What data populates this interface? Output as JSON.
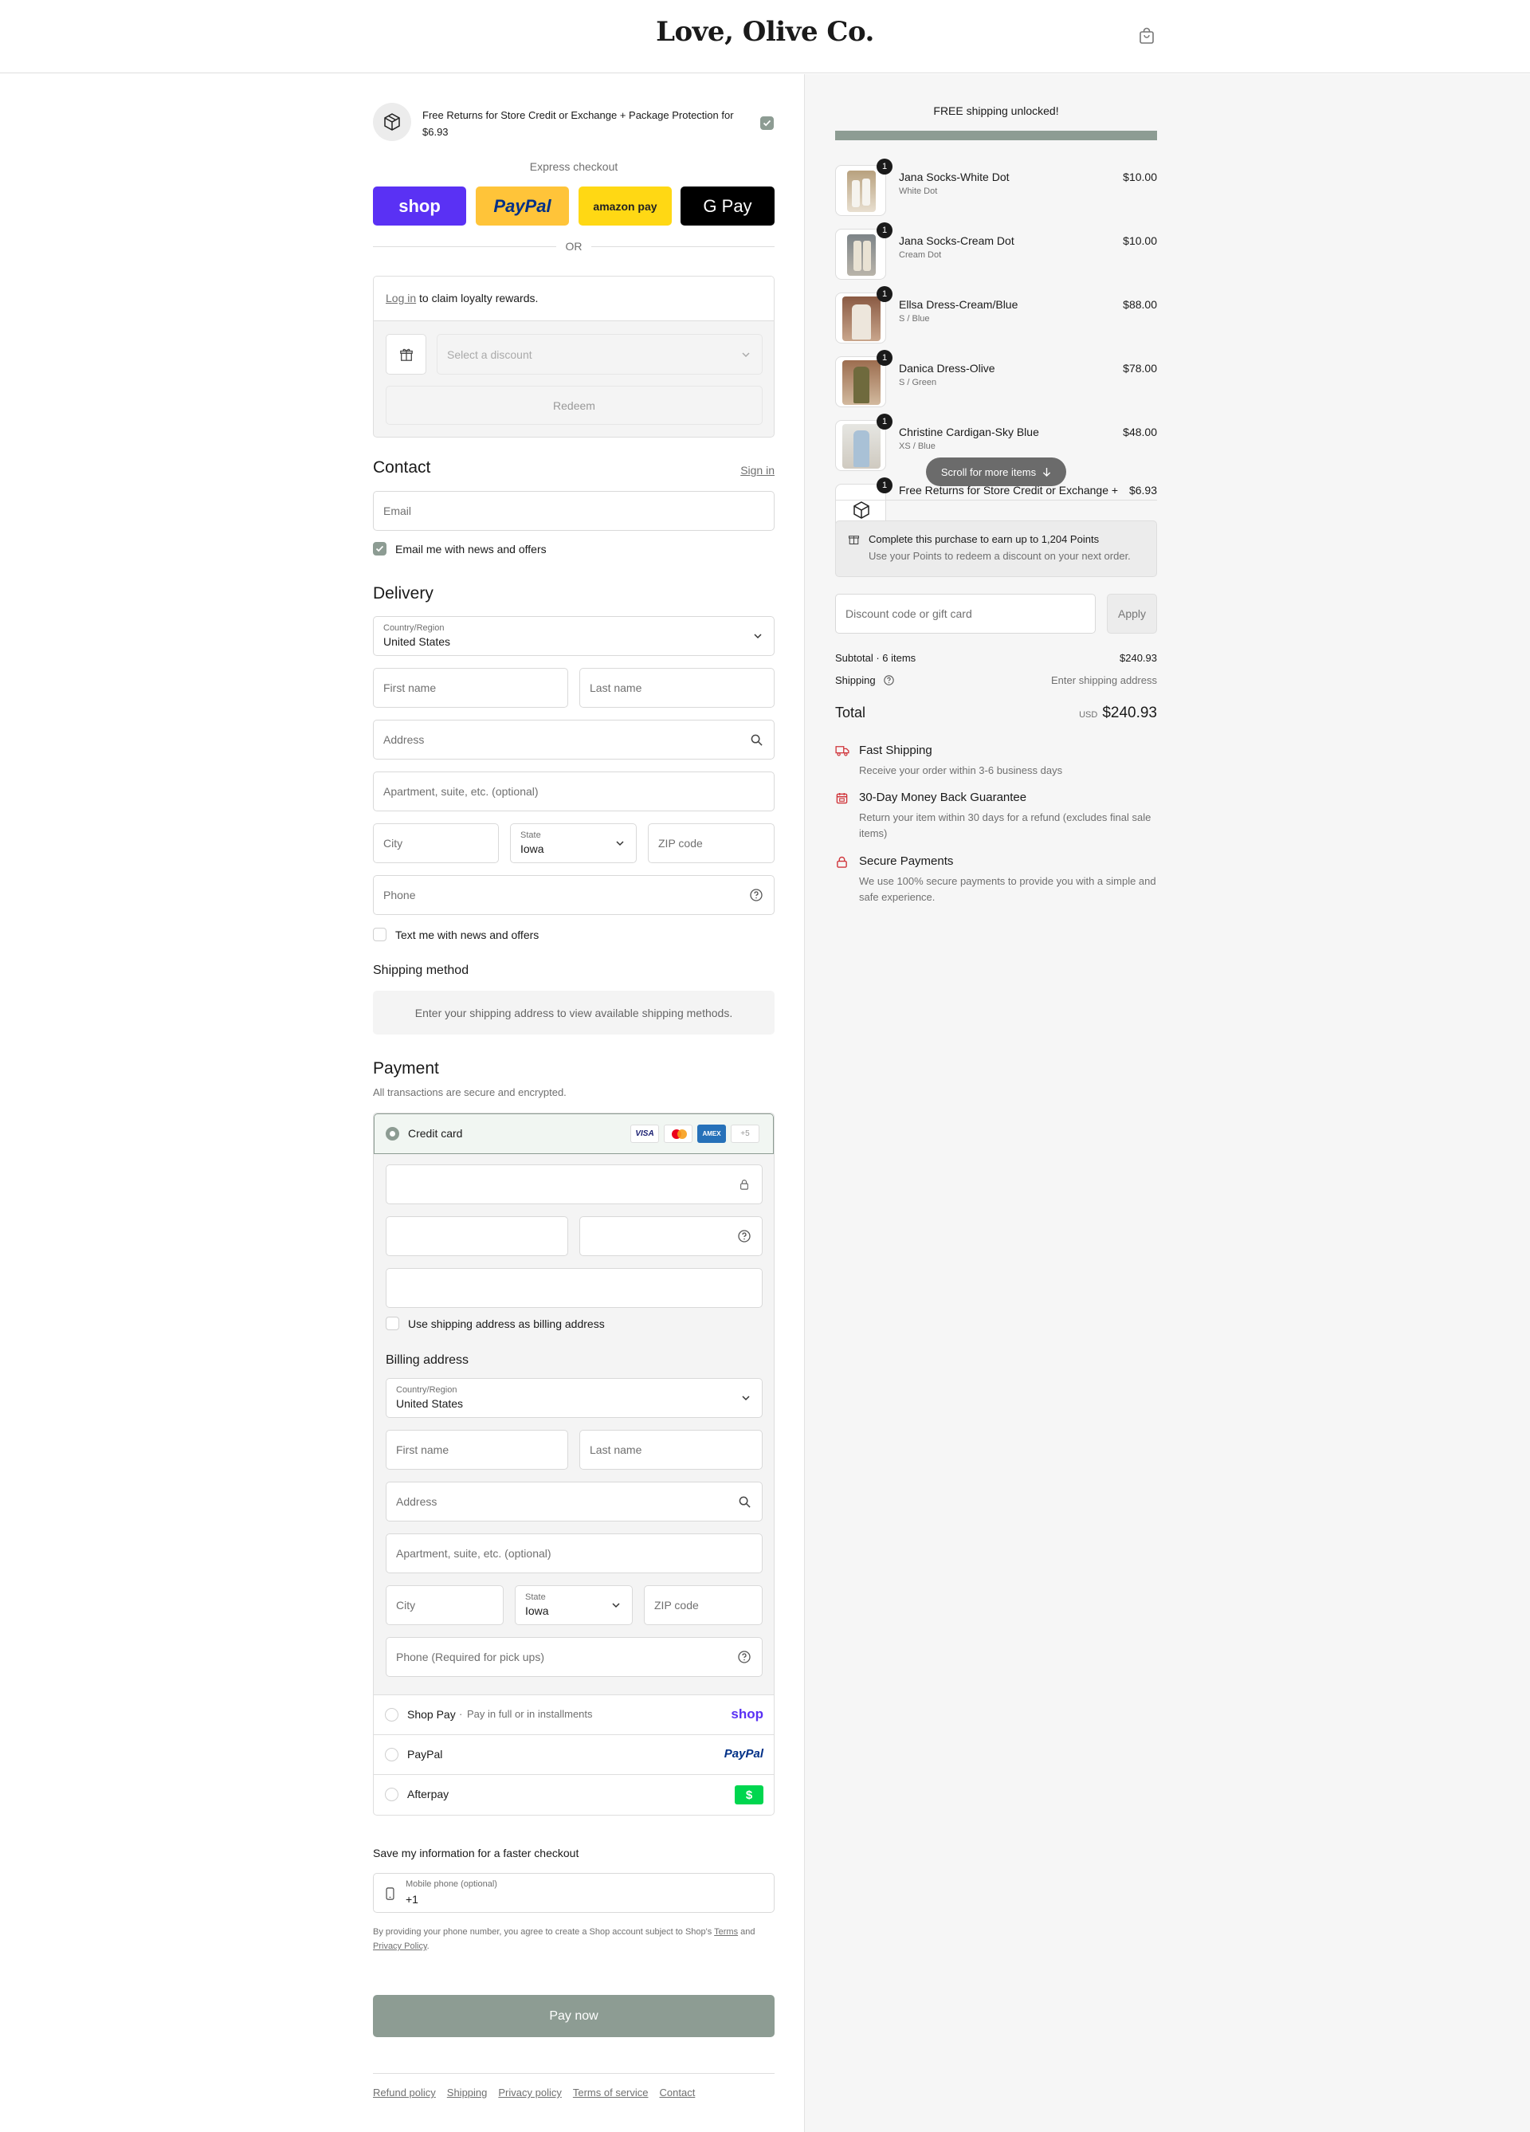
{
  "header": {
    "brand": "Love, Olive Co.",
    "cart_icon": "shopping-bag-icon"
  },
  "protection": {
    "text": "Free Returns for Store Credit or Exchange + Package Protection for $6.93",
    "checked": true
  },
  "express": {
    "label": "Express checkout",
    "shop_label": "shop",
    "paypal_label": "PayPal",
    "amazon_label": "amazon pay",
    "gpay_label": "G Pay",
    "or": "OR"
  },
  "loyalty": {
    "login_link": "Log in",
    "text": "to claim loyalty rewards.",
    "discount_placeholder": "Select a discount",
    "redeem": "Redeem"
  },
  "contact": {
    "title": "Contact",
    "sign_in": "Sign in",
    "email_placeholder": "Email",
    "news_label": "Email me with news and offers",
    "news_checked": true
  },
  "delivery": {
    "title": "Delivery",
    "country_label": "Country/Region",
    "country": "United States",
    "first_name": "First name",
    "last_name": "Last name",
    "address": "Address",
    "apartment": "Apartment, suite, etc. (optional)",
    "city": "City",
    "state_label": "State",
    "state": "Iowa",
    "zip": "ZIP code",
    "phone": "Phone",
    "text_label": "Text me with news and offers"
  },
  "shipping_method": {
    "title": "Shipping method",
    "message": "Enter your shipping address to view available shipping methods."
  },
  "payment": {
    "title": "Payment",
    "subtitle": "All transactions are secure and encrypted.",
    "credit_card": "Credit card",
    "card_brands": [
      "VISA",
      "MC",
      "AMEX",
      "+5"
    ],
    "use_shipping": "Use shipping address as billing address",
    "billing_title": "Billing address",
    "billing_country_label": "Country/Region",
    "billing_country": "United States",
    "billing_first": "First name",
    "billing_last": "Last name",
    "billing_address": "Address",
    "billing_apartment": "Apartment, suite, etc. (optional)",
    "billing_city": "City",
    "billing_state_label": "State",
    "billing_state": "Iowa",
    "billing_zip": "ZIP code",
    "billing_phone": "Phone (Required for pick ups)",
    "shop_pay": "Shop Pay",
    "shop_pay_note": "Pay in full or in installments",
    "shop_pay_logo": "shop",
    "paypal": "PayPal",
    "paypal_logo": "PayPal",
    "afterpay": "Afterpay",
    "afterpay_logo": "$"
  },
  "save_info": {
    "title": "Save my information for a faster checkout",
    "mobile_label": "Mobile phone (optional)",
    "mobile_value": "+1",
    "legal_1": "By providing your phone number, you agree to create a Shop account subject to Shop's",
    "terms": "Terms",
    "and": "and",
    "privacy": "Privacy Policy",
    "period": "."
  },
  "pay_now": "Pay now",
  "footer": [
    "Refund policy",
    "Shipping",
    "Privacy policy",
    "Terms of service",
    "Contact"
  ],
  "summary": {
    "free_shipping": "FREE shipping unlocked!",
    "progress": 1.0,
    "items": [
      {
        "qty": "1",
        "name": "Jana Socks-White Dot",
        "variant": "White Dot",
        "price": "$10.00"
      },
      {
        "qty": "1",
        "name": "Jana Socks-Cream Dot",
        "variant": "Cream Dot",
        "price": "$10.00"
      },
      {
        "qty": "1",
        "name": "Ellsa Dress-Cream/Blue",
        "variant": "S / Blue",
        "price": "$88.00"
      },
      {
        "qty": "1",
        "name": "Danica Dress-Olive",
        "variant": "S / Green",
        "price": "$78.00"
      },
      {
        "qty": "1",
        "name": "Christine Cardigan-Sky Blue",
        "variant": "XS / Blue",
        "price": "$48.00"
      },
      {
        "qty": "1",
        "name": "Free Returns for Store Credit or Exchange +",
        "variant": "",
        "price": "$6.93"
      }
    ],
    "scroll_hint": "Scroll for more items",
    "points_title": "Complete this purchase to earn up to 1,204 Points",
    "points_sub": "Use your Points to redeem a discount on your next order.",
    "discount_placeholder": "Discount code or gift card",
    "apply": "Apply",
    "subtotal_label": "Subtotal · 6 items",
    "subtotal": "$240.93",
    "shipping_label": "Shipping",
    "shipping_value": "Enter shipping address",
    "total_label": "Total",
    "currency": "USD",
    "total": "$240.93",
    "perks": [
      {
        "icon": "truck-icon",
        "title": "Fast Shipping",
        "text": "Receive your order within 3-6 business days"
      },
      {
        "icon": "calendar-icon",
        "title": "30-Day Money Back Guarantee",
        "text": "Return your item within 30 days for a refund (excludes final sale items)"
      },
      {
        "icon": "lock-icon",
        "title": "Secure Payments",
        "text": "We use 100% secure payments to provide you with a simple and safe experience."
      }
    ]
  },
  "colors": {
    "accent": "#8d9c93",
    "shop_purple": "#5a31f4",
    "paypal_yellow": "#ffc439",
    "amazon_yellow": "#ffd814",
    "perk_red": "#d0343a"
  }
}
